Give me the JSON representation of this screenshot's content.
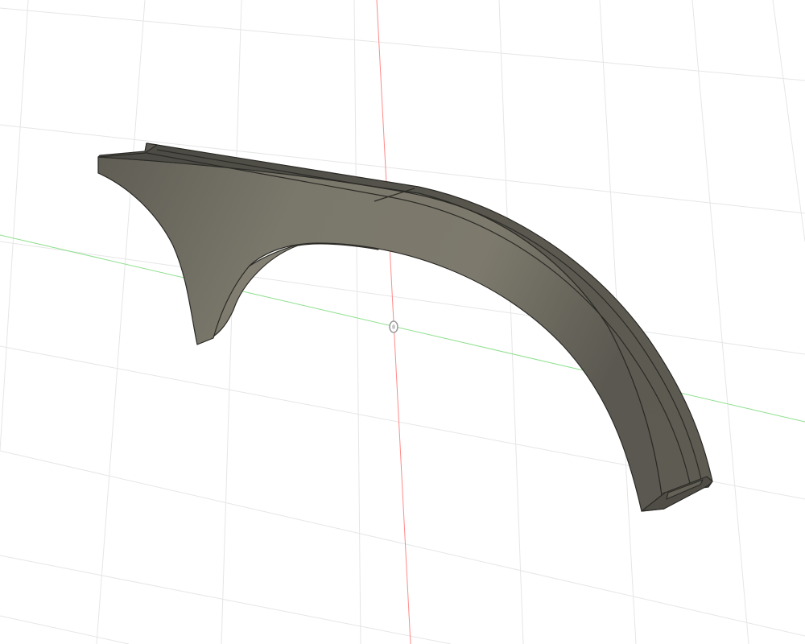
{
  "viewport": {
    "background": "#ffffff",
    "grid_color": "#e6e6e6",
    "x_axis_color": "#ff8a8a",
    "y_axis_color": "#8fe08f",
    "model_color": "#6e6b60",
    "model_edge_color": "#2b2a26"
  }
}
